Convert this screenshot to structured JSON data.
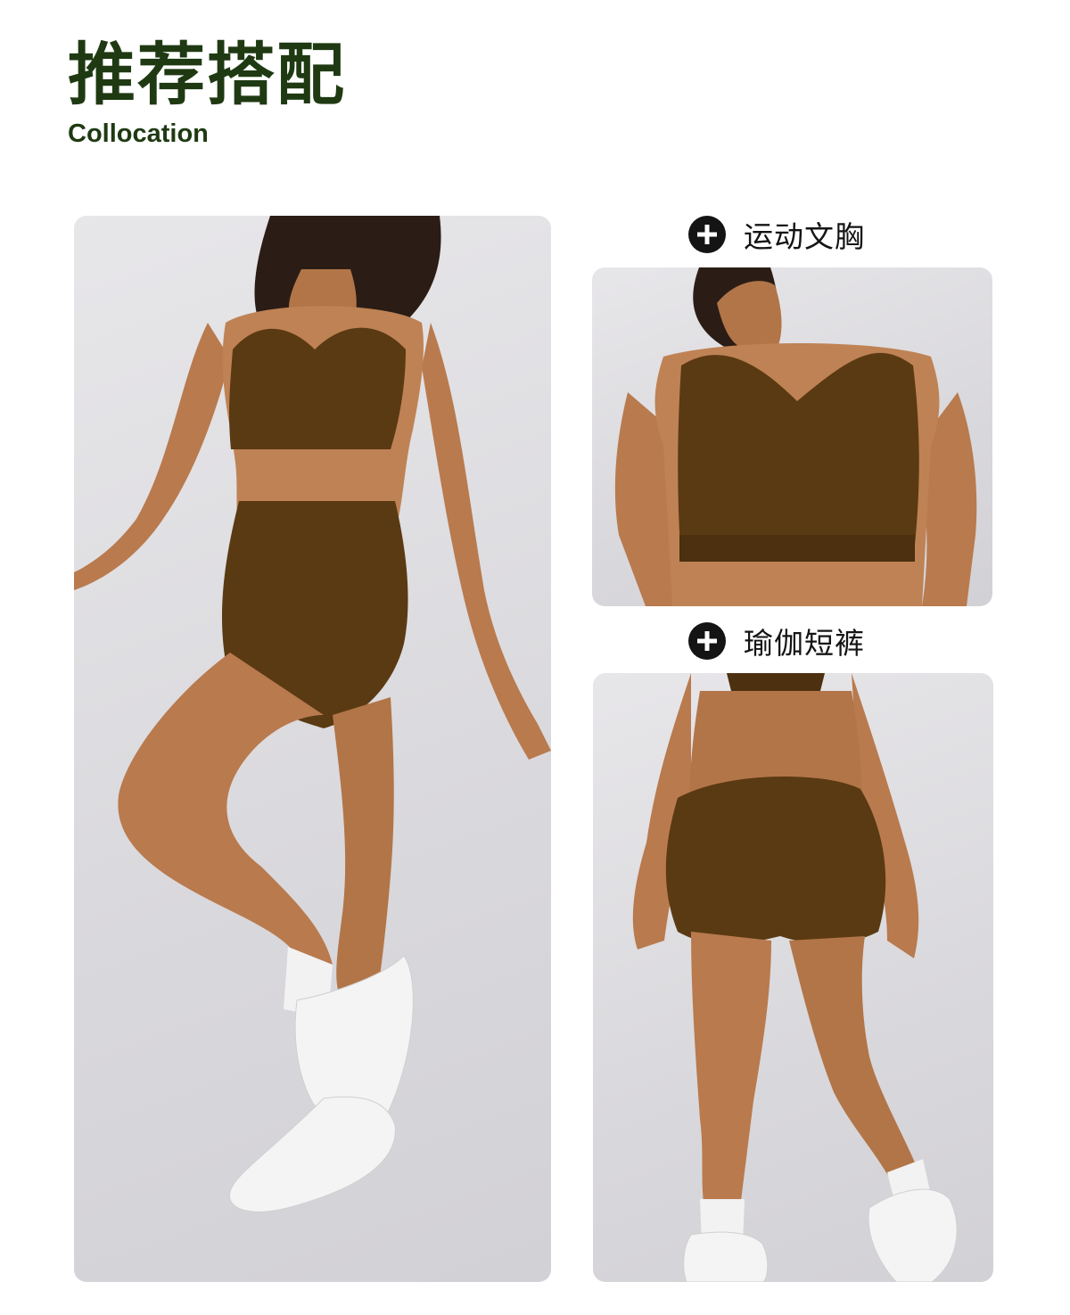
{
  "header": {
    "title_cn": "推荐搭配",
    "title_en": "Collocation"
  },
  "items": [
    {
      "label": "运动文胸",
      "icon": "plus-circle-icon"
    },
    {
      "label": "瑜伽短裤",
      "icon": "plus-circle-icon"
    }
  ],
  "colors": {
    "title": "#1f3a12",
    "garment": "#5a3a12",
    "skin": "#b97a4e",
    "photo_background": "#dddce0"
  }
}
